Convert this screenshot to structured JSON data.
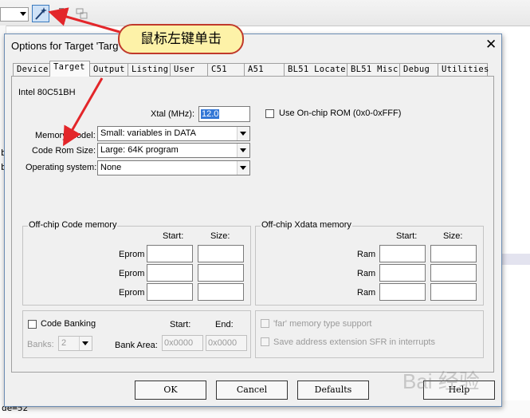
{
  "dialog": {
    "title": "Options for Target 'Targ",
    "close_symbol": "✕",
    "tabs": [
      "Device",
      "Target",
      "Output",
      "Listing",
      "User",
      "C51",
      "A51",
      "BL51 Locate",
      "BL51 Misc",
      "Debug",
      "Utilities"
    ],
    "active_tab": "Target"
  },
  "target": {
    "device_name": "Intel 80C51BH",
    "xtal_label": "Xtal (MHz):",
    "xtal_value": "12.0",
    "onchip_rom_label": "Use On-chip ROM (0x0-0xFFF)",
    "memory_model_label": "Memory Model:",
    "memory_model_value": "Small: variables in DATA",
    "code_rom_size_label": "Code Rom Size:",
    "code_rom_size_value": "Large: 64K program",
    "os_label": "Operating system:",
    "os_value": "None"
  },
  "code_memory": {
    "legend": "Off-chip Code memory",
    "start_header": "Start:",
    "size_header": "Size:",
    "rows": [
      "Eprom",
      "Eprom",
      "Eprom"
    ]
  },
  "xdata_memory": {
    "legend": "Off-chip Xdata memory",
    "start_header": "Start:",
    "size_header": "Size:",
    "rows": [
      "Ram",
      "Ram",
      "Ram"
    ]
  },
  "banking": {
    "code_banking_label": "Code Banking",
    "start_header": "Start:",
    "end_header": "End:",
    "banks_label": "Banks:",
    "banks_value": "2",
    "bank_area_label": "Bank Area:",
    "bank_area_start": "0x0000",
    "bank_area_end": "0x0000"
  },
  "options": {
    "far_memory_label": "'far' memory type support",
    "save_sfr_label": "Save address extension SFR in interrupts"
  },
  "buttons": {
    "ok": "OK",
    "cancel": "Cancel",
    "defaults": "Defaults",
    "help": "Help"
  },
  "annotation": {
    "callout_text": "鼠标左键单击",
    "watermark": "Bai 经验"
  },
  "ide": {
    "status_text": "de=52",
    "side_chars": [
      "b",
      "b"
    ]
  },
  "colors": {
    "callout_bg": "#fdf2a8",
    "callout_border": "#c0392b",
    "arrow": "#e3262a",
    "dialog_border": "#6c8db4"
  }
}
